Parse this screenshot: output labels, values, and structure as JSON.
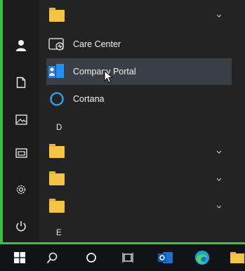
{
  "rail": {
    "items": [
      {
        "name": "user-icon"
      },
      {
        "name": "documents-icon"
      },
      {
        "name": "pictures-icon"
      },
      {
        "name": "file-explorer-icon"
      },
      {
        "name": "settings-icon"
      },
      {
        "name": "power-icon"
      }
    ]
  },
  "apps": {
    "care_center": "Care Center",
    "company_portal": "Company Portal",
    "cortana": "Cortana",
    "letter_d": "D",
    "letter_e": "E"
  },
  "taskbar": {
    "items": [
      {
        "name": "windows-start-icon"
      },
      {
        "name": "search-icon"
      },
      {
        "name": "cortana-circle-icon"
      },
      {
        "name": "task-view-icon"
      },
      {
        "name": "outlook-icon"
      },
      {
        "name": "edge-icon"
      },
      {
        "name": "file-explorer-icon"
      }
    ]
  },
  "colors": {
    "folder": "#f4c542",
    "accent_green": "#33c83a",
    "selected_row": "#3a3f45",
    "company_portal_blue": "#1e90ff"
  }
}
